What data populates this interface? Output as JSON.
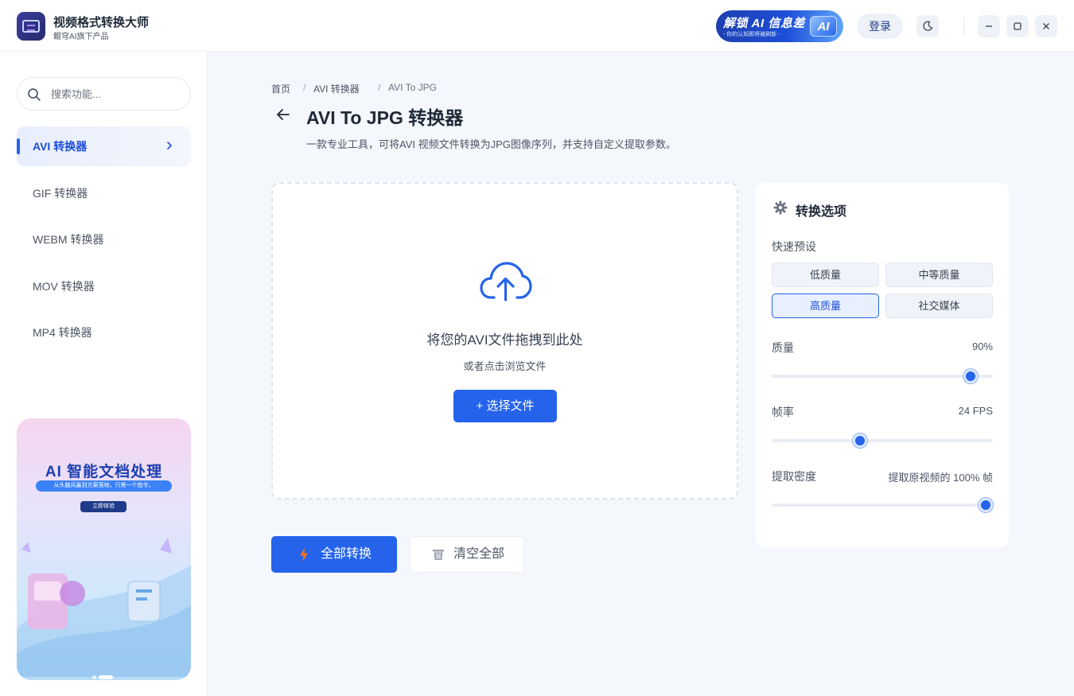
{
  "app": {
    "title": "视频格式转换大师",
    "subtitle": "鲲穹AI旗下产品"
  },
  "header": {
    "ad": {
      "line1": "解锁 AI 信息差",
      "line2": "- 你的认知即将被刷新 -",
      "badge": "AI"
    },
    "login_label": "登录"
  },
  "sidebar": {
    "search_placeholder": "搜索功能...",
    "items": [
      {
        "label": "AVI 转换器",
        "active": true
      },
      {
        "label": "GIF 转换器",
        "active": false
      },
      {
        "label": "WEBM 转换器",
        "active": false
      },
      {
        "label": "MOV 转换器",
        "active": false
      },
      {
        "label": "MP4 转换器",
        "active": false
      }
    ],
    "promo": {
      "title": "AI 智能文档处理",
      "subtitle": "从头脑风暴到方案落地，只需一个指令。",
      "button": "立即体验"
    }
  },
  "breadcrumb": [
    "首页",
    "AVI 转换器",
    "AVI To JPG"
  ],
  "page": {
    "title": "AVI To JPG 转换器",
    "description": "一款专业工具，可将AVI 视频文件转换为JPG图像序列，并支持自定义提取参数。"
  },
  "dropzone": {
    "title": "将您的AVI文件拖拽到此处",
    "subtitle": "或者点击浏览文件",
    "button": "+  选择文件"
  },
  "actions": {
    "convert_all": "全部转换",
    "clear_all": "清空全部"
  },
  "options": {
    "title": "转换选项",
    "presets_label": "快速预设",
    "presets": [
      {
        "label": "低质量",
        "selected": false
      },
      {
        "label": "中等质量",
        "selected": false
      },
      {
        "label": "高质量",
        "selected": true
      },
      {
        "label": "社交媒体",
        "selected": false
      }
    ],
    "quality": {
      "label": "质量",
      "value_text": "90%",
      "level": 0.9
    },
    "framerate": {
      "label": "帧率",
      "value_text": "24 FPS",
      "level": 0.4
    },
    "density": {
      "label": "提取密度",
      "value_text": "提取原视频的 100% 帧",
      "level": 1.0
    }
  },
  "colors": {
    "accent": "#2563eb",
    "background": "#f4f7fc"
  }
}
